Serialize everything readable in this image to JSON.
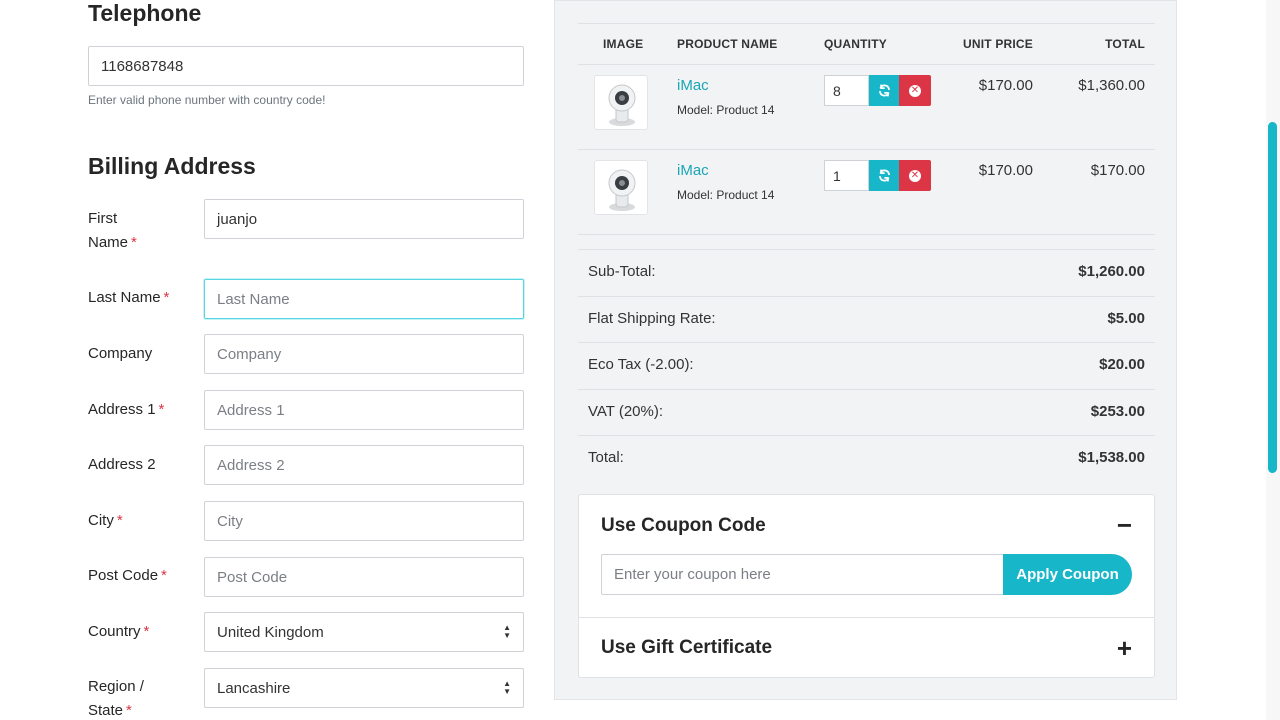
{
  "telephone": {
    "title": "Telephone",
    "value": "1168687848",
    "help": "Enter valid phone number with country code!"
  },
  "billing": {
    "title": "Billing Address",
    "fields": [
      {
        "label": "First Name",
        "required": "*",
        "value": "juanjo",
        "placeholder": ""
      },
      {
        "label": "Last Name",
        "required": "*",
        "value": "",
        "placeholder": "Last Name"
      },
      {
        "label": "Company",
        "required": "",
        "value": "",
        "placeholder": "Company"
      },
      {
        "label": "Address 1",
        "required": "*",
        "value": "",
        "placeholder": "Address 1"
      },
      {
        "label": "Address 2",
        "required": "",
        "value": "",
        "placeholder": "Address 2"
      },
      {
        "label": "City",
        "required": "*",
        "value": "",
        "placeholder": "City"
      },
      {
        "label": "Post Code",
        "required": "*",
        "value": "",
        "placeholder": "Post Code"
      },
      {
        "label": "Country",
        "required": "*",
        "value": "United Kingdom",
        "placeholder": ""
      },
      {
        "label": "Region / State",
        "required": "*",
        "value": "Lancashire",
        "placeholder": ""
      }
    ]
  },
  "cart": {
    "headers": {
      "image": "IMAGE",
      "name": "PRODUCT NAME",
      "quantity": "QUANTITY",
      "unit_price": "UNIT PRICE",
      "total": "TOTAL"
    },
    "items": [
      {
        "name": "iMac",
        "model": "Model: Product 14",
        "quantity": "8",
        "unit_price": "$170.00",
        "total": "$1,360.00"
      },
      {
        "name": "iMac",
        "model": "Model: Product 14",
        "quantity": "1",
        "unit_price": "$170.00",
        "total": "$170.00"
      }
    ],
    "totals": [
      {
        "label": "Sub-Total:",
        "value": "$1,260.00"
      },
      {
        "label": "Flat Shipping Rate:",
        "value": "$5.00"
      },
      {
        "label": "Eco Tax (-2.00):",
        "value": "$20.00"
      },
      {
        "label": "VAT (20%):",
        "value": "$253.00"
      },
      {
        "label": "Total:",
        "value": "$1,538.00"
      }
    ]
  },
  "coupon": {
    "title": "Use Coupon Code",
    "toggle": "−",
    "placeholder": "Enter your coupon here",
    "button": "Apply Coupon"
  },
  "gift": {
    "title": "Use Gift Certificate",
    "toggle": "+"
  },
  "icons": {
    "refresh": "refresh-icon",
    "remove": "remove-icon",
    "select": "select-arrows-icon",
    "thumbnail": "webcam-product-image"
  },
  "colors": {
    "accent": "#17b6c9",
    "link": "#1aa6b7",
    "danger": "#dc3545",
    "panel": "#f2f3f5",
    "focus": "#55d7e3"
  }
}
